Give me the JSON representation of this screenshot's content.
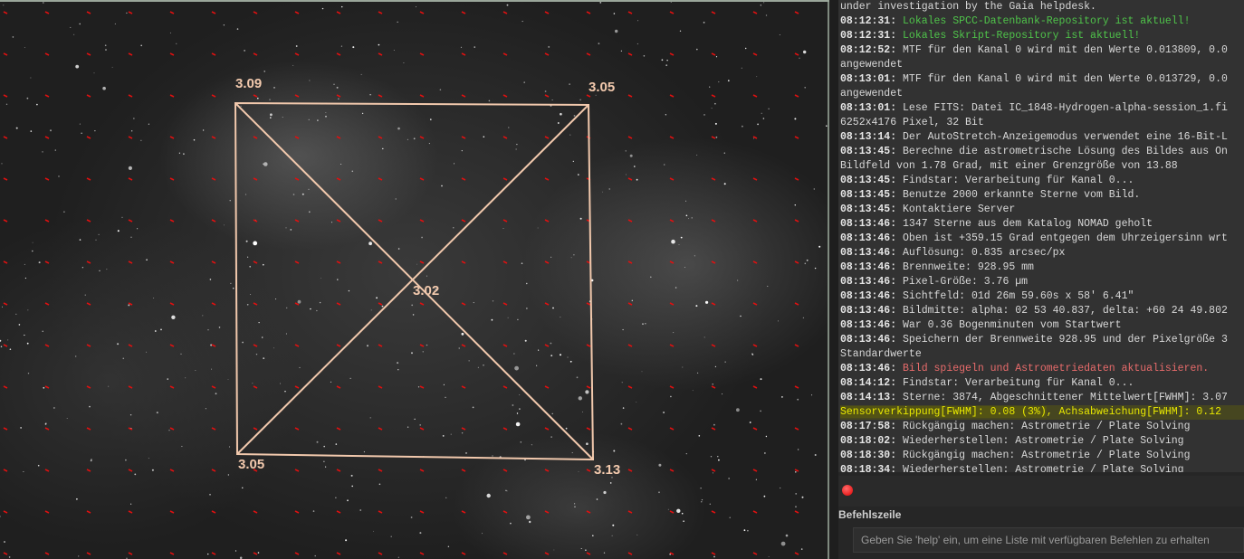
{
  "image_view": {
    "tilt_values": {
      "top_left": "3.09",
      "top_right": "3.05",
      "center": "3.02",
      "bottom_left": "3.05",
      "bottom_right": "3.13"
    },
    "overlay_color": "#f2c9ad",
    "grid_marker_color": "#e01010"
  },
  "console": {
    "lines": [
      {
        "ts": "",
        "msg": "under investigation by the Gaia helpdesk.",
        "style": ""
      },
      {
        "ts": "08:12:31:",
        "msg": " Lokales SPCC-Datenbank-Repository ist aktuell!",
        "style": "green"
      },
      {
        "ts": "08:12:31:",
        "msg": " Lokales Skript-Repository ist aktuell!",
        "style": "green"
      },
      {
        "ts": "08:12:52:",
        "msg": " MTF für den Kanal 0 wird mit den Werte 0.013809, 0.0",
        "style": ""
      },
      {
        "ts": "",
        "msg": "angewendet",
        "style": ""
      },
      {
        "ts": "08:13:01:",
        "msg": " MTF für den Kanal 0 wird mit den Werte 0.013729, 0.0",
        "style": ""
      },
      {
        "ts": "",
        "msg": "angewendet",
        "style": ""
      },
      {
        "ts": "08:13:01:",
        "msg": " Lese FITS: Datei IC_1848-Hydrogen-alpha-session_1.fi",
        "style": ""
      },
      {
        "ts": "",
        "msg": "6252x4176 Pixel, 32 Bit",
        "style": ""
      },
      {
        "ts": "08:13:14:",
        "msg": " Der AutoStretch-Anzeigemodus verwendet eine 16-Bit-L",
        "style": ""
      },
      {
        "ts": "08:13:45:",
        "msg": " Berechne die astrometrische Lösung des Bildes aus On",
        "style": ""
      },
      {
        "ts": "",
        "msg": "Bildfeld von 1.78 Grad, mit einer Grenzgröße von 13.88",
        "style": ""
      },
      {
        "ts": "08:13:45:",
        "msg": " Findstar: Verarbeitung für Kanal 0...",
        "style": ""
      },
      {
        "ts": "08:13:45:",
        "msg": " Benutze 2000 erkannte Sterne vom Bild.",
        "style": ""
      },
      {
        "ts": "08:13:45:",
        "msg": " Kontaktiere Server",
        "style": ""
      },
      {
        "ts": "08:13:46:",
        "msg": " 1347 Sterne aus dem Katalog NOMAD geholt",
        "style": ""
      },
      {
        "ts": "08:13:46:",
        "msg": " Oben ist +359.15 Grad entgegen dem Uhrzeigersinn wrt",
        "style": ""
      },
      {
        "ts": "08:13:46:",
        "msg": " Auflösung:      0.835 arcsec/px",
        "style": ""
      },
      {
        "ts": "08:13:46:",
        "msg": " Brennweite:   928.95 mm",
        "style": ""
      },
      {
        "ts": "08:13:46:",
        "msg": " Pixel-Größe:      3.76 µm",
        "style": ""
      },
      {
        "ts": "08:13:46:",
        "msg": " Sichtfeld:    01d 26m 59.60s x 58' 6.41\"",
        "style": ""
      },
      {
        "ts": "08:13:46:",
        "msg": " Bildmitte: alpha: 02 53 40.837, delta: +60 24 49.802",
        "style": ""
      },
      {
        "ts": "08:13:46:",
        "msg": " War 0.36 Bogenminuten vom Startwert",
        "style": ""
      },
      {
        "ts": "08:13:46:",
        "msg": " Speichern der Brennweite 928.95 und der Pixelgröße 3",
        "style": ""
      },
      {
        "ts": "",
        "msg": "Standardwerte",
        "style": ""
      },
      {
        "ts": "08:13:46:",
        "msg": " Bild spiegeln und Astrometriedaten aktualisieren.",
        "style": "red"
      },
      {
        "ts": "08:14:12:",
        "msg": " Findstar: Verarbeitung für Kanal 0...",
        "style": ""
      },
      {
        "ts": "08:14:13:",
        "msg": " Sterne: 3874, Abgeschnittener Mittelwert[FWHM]: 3.07",
        "style": ""
      },
      {
        "ts": "",
        "msg": "",
        "hl": "Sensorverkippung[FWHM]: 0.08 (3%)",
        "rest": ", Achsabweichung[FWHM]: 0.12",
        "style": "hl"
      },
      {
        "ts": "08:17:58:",
        "msg": " Rückgängig machen: Astrometrie / Plate Solving",
        "style": ""
      },
      {
        "ts": "08:18:02:",
        "msg": " Wiederherstellen: Astrometrie / Plate Solving",
        "style": ""
      },
      {
        "ts": "08:18:30:",
        "msg": " Rückgängig machen: Astrometrie / Plate Solving",
        "style": ""
      },
      {
        "ts": "08:18:34:",
        "msg": " Wiederherstellen: Astrometrie / Plate Solving",
        "style": ""
      }
    ],
    "command_label": "Befehlszeile",
    "command_placeholder": "Geben Sie 'help' ein, um eine Liste mit verfügbaren Befehlen zu erhalten",
    "status_color": "#e00000"
  }
}
